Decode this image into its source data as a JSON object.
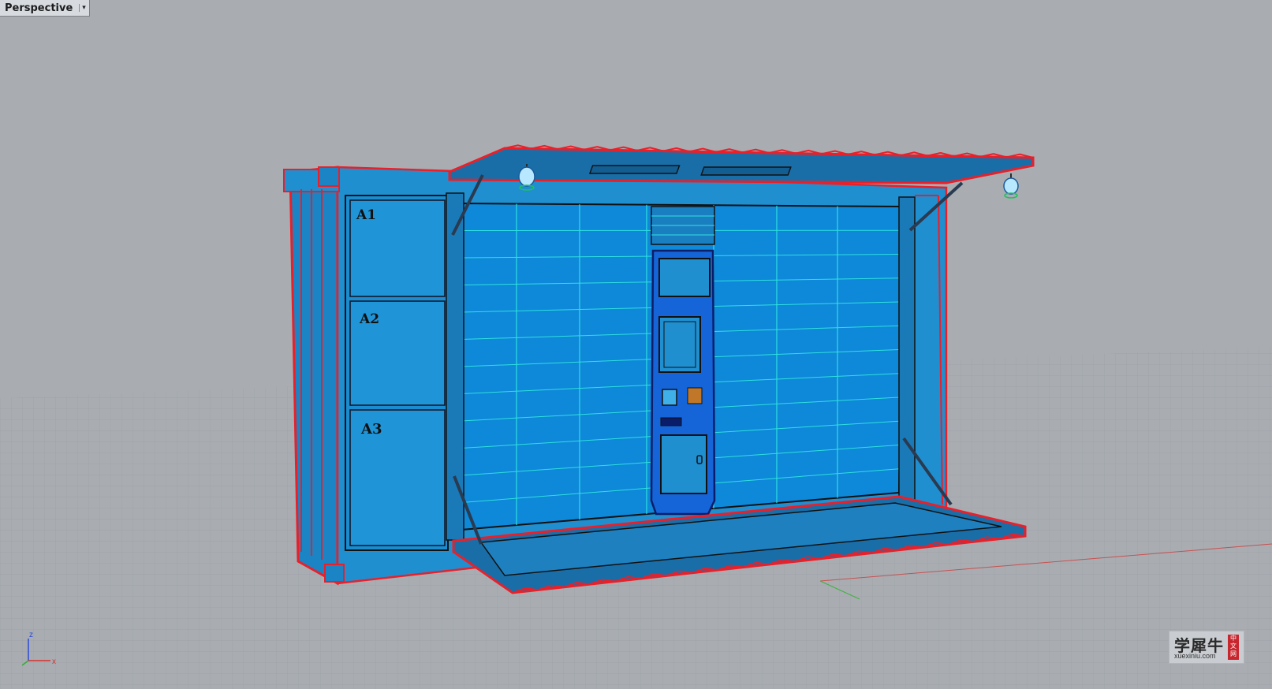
{
  "viewport": {
    "name": "Perspective",
    "menu_caret": "▾"
  },
  "axes": {
    "z": "z",
    "x": "x"
  },
  "model": {
    "locker_labels": [
      "A1",
      "A2",
      "A3"
    ]
  },
  "watermark": {
    "title": "学犀牛",
    "url": "xuexiniu.com",
    "seal": "中文网"
  },
  "colors": {
    "background": "#a9adb2",
    "grid": "#9da1a6",
    "model_fill": "#1f8fd0",
    "edge_red": "#e8202a",
    "edge_cyan": "#30e0e0",
    "edge_green": "#40e040"
  }
}
